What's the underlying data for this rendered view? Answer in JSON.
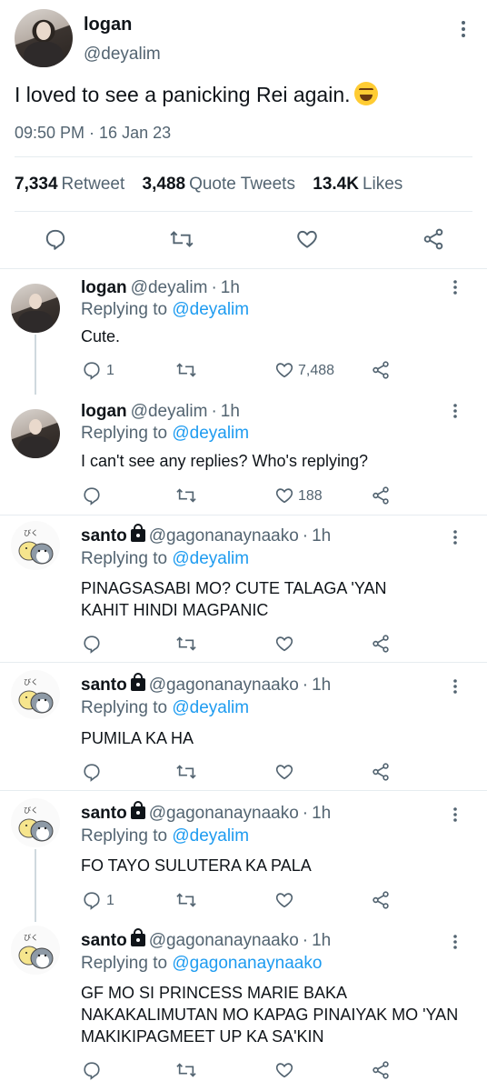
{
  "main": {
    "name": "logan",
    "handle": "@deyalim",
    "text": "I loved to see a panicking Rei again.",
    "emoji": "grinning-squinting-face",
    "time": "09:50 PM · 16 Jan 23",
    "stats": [
      {
        "num": "7,334",
        "label": "Retweet"
      },
      {
        "num": "3,488",
        "label": "Quote Tweets"
      },
      {
        "num": "13.4K",
        "label": "Likes"
      }
    ]
  },
  "replying_label": "Replying to",
  "replies": [
    {
      "name": "logan",
      "handle": "@deyalim",
      "sep": "·",
      "time": "1h",
      "locked": false,
      "replying_to": "@deyalim",
      "text": "Cute.",
      "reply_count": "1",
      "like_count": "7,488"
    },
    {
      "name": "logan",
      "handle": "@deyalim",
      "sep": "·",
      "time": "1h",
      "locked": false,
      "replying_to": "@deyalim",
      "text": "I can't see any replies? Who's replying?",
      "reply_count": "",
      "like_count": "188"
    },
    {
      "name": "santo",
      "handle": "@gagonanaynaako",
      "sep": "·",
      "time": "1h",
      "locked": true,
      "replying_to": "@deyalim",
      "text": "PINAGSASABI MO? CUTE TALAGA 'YAN KAHIT HINDI MAGPANIC",
      "reply_count": "",
      "like_count": ""
    },
    {
      "name": "santo",
      "handle": "@gagonanaynaako",
      "sep": "·",
      "time": "1h",
      "locked": true,
      "replying_to": "@deyalim",
      "text": "PUMILA KA HA",
      "reply_count": "",
      "like_count": ""
    },
    {
      "name": "santo",
      "handle": "@gagonanaynaako",
      "sep": "·",
      "time": "1h",
      "locked": true,
      "replying_to": "@deyalim",
      "text": "FO TAYO SULUTERA KA PALA",
      "reply_count": "1",
      "like_count": ""
    },
    {
      "name": "santo",
      "handle": "@gagonanaynaako",
      "sep": "·",
      "time": "1h",
      "locked": true,
      "replying_to": "@gagonanaynaako",
      "text": "GF MO SI PRINCESS MARIE BAKA NAKAKALIMUTAN MO KAPAG PINAIYAK MO 'YAN MAKIKIPAGMEET UP KA SA'KIN",
      "reply_count": "",
      "like_count": ""
    }
  ],
  "colors": {
    "accent": "#1d9bf0",
    "muted": "#536471",
    "text": "#0f1419",
    "divider": "#e6ecf0"
  }
}
